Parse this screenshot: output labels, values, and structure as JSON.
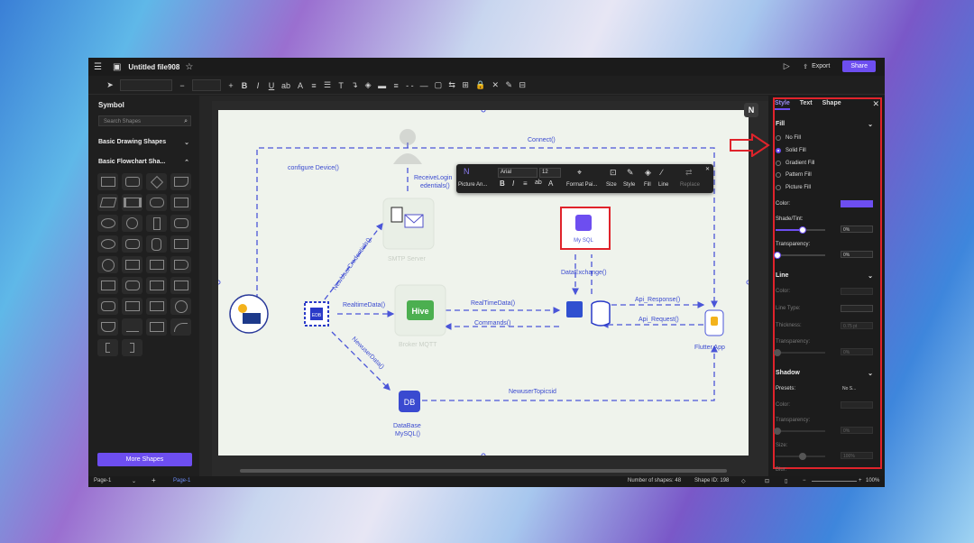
{
  "window": {
    "title": "Untitled file908",
    "export_label": "Export",
    "share_label": "Share"
  },
  "toolbar": {
    "font_size": "",
    "zoom": ""
  },
  "sidebar": {
    "title": "Symbol",
    "search_placeholder": "Search Shapes",
    "sections": [
      {
        "label": "Basic Drawing Shapes"
      },
      {
        "label": "Basic Flowchart Sha..."
      }
    ],
    "more_shapes": "More Shapes"
  },
  "float_toolbar": {
    "picture_label": "Picture An...",
    "font": "Arial",
    "size": "12",
    "format_painter": "Format Pai...",
    "size_label": "Size",
    "style_label": "Style",
    "fill_label": "Fill",
    "line_label": "Line",
    "replace_label": "Replace"
  },
  "diagram": {
    "labels": {
      "connect": "Connect()",
      "configure": "configure Device()",
      "receive_login_1": "ReceiveLogin",
      "receive_login_2": "edentials()",
      "new_user_cred": "NewUserCredentials()",
      "realtime1": "RealtimeData()",
      "realtime2": "RealTimeData()",
      "commands": "Commands()",
      "data_exchange": "DataExchange()",
      "api_response": "Api_Response()",
      "api_request": "Api_Request()",
      "new_user_data": "NewuserData()",
      "new_user_topics": "NewuserTopicsid",
      "smtp": "SMTP Server",
      "broker": "Broker MQTT",
      "flutter": "Flutter App",
      "db1": "DataBase",
      "db2": "MySQL()",
      "hive": "Hive",
      "db_icon": "DB",
      "chip": "EDB",
      "mysql": "My SQL"
    }
  },
  "panel": {
    "tabs": [
      "Style",
      "Text",
      "Shape"
    ],
    "fill": {
      "title": "Fill",
      "options": [
        "No Fill",
        "Solid Fill",
        "Gradient Fill",
        "Pattern Fill",
        "Picture Fill"
      ],
      "selected": "Solid Fill",
      "color_label": "Color:",
      "color": "#6d4ef0",
      "shade_label": "Shade/Tint:",
      "shade_value": "0%",
      "transparency_label": "Transparency:",
      "transparency_value": "0%"
    },
    "line": {
      "title": "Line",
      "color_label": "Color:",
      "type_label": "Line Type:",
      "thickness_label": "Thickness:",
      "thickness_value": "0.75 pt",
      "transparency_label": "Transparency:",
      "transparency_value": "0%"
    },
    "shadow": {
      "title": "Shadow",
      "presets_label": "Presets:",
      "presets_value": "No S...",
      "color_label": "Color:",
      "transparency_label": "Transparency:",
      "transparency_value": "0%",
      "size_label": "Size:",
      "size_value": "100%",
      "blur_label": "Blur:"
    }
  },
  "statusbar": {
    "page_select": "Page-1",
    "page_tab": "Page-1",
    "shapes": "Number of shapes: 48",
    "shape_id": "Shape ID: 198",
    "zoom": "100%"
  }
}
